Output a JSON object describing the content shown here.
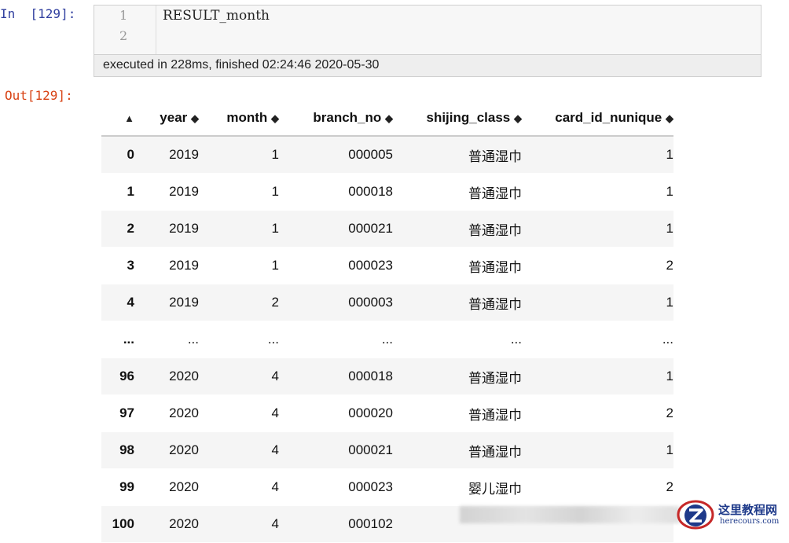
{
  "input_cell": {
    "prompt": "In  [129]:",
    "line_numbers": [
      "1",
      "2"
    ],
    "code": "RESULT_month",
    "exec_info": "executed in 228ms, finished 02:24:46 2020-05-30"
  },
  "output_cell": {
    "prompt": "Out[129]:",
    "sort_icon": "sort-arrows-icon",
    "columns": [
      "year",
      "month",
      "branch_no",
      "shijing_class",
      "card_id_nunique"
    ],
    "rows": [
      {
        "index": "0",
        "year": "2019",
        "month": "1",
        "branch_no": "000005",
        "shijing_class": "普通湿巾",
        "card_id_nunique": "1"
      },
      {
        "index": "1",
        "year": "2019",
        "month": "1",
        "branch_no": "000018",
        "shijing_class": "普通湿巾",
        "card_id_nunique": "1"
      },
      {
        "index": "2",
        "year": "2019",
        "month": "1",
        "branch_no": "000021",
        "shijing_class": "普通湿巾",
        "card_id_nunique": "1"
      },
      {
        "index": "3",
        "year": "2019",
        "month": "1",
        "branch_no": "000023",
        "shijing_class": "普通湿巾",
        "card_id_nunique": "2"
      },
      {
        "index": "4",
        "year": "2019",
        "month": "2",
        "branch_no": "000003",
        "shijing_class": "普通湿巾",
        "card_id_nunique": "1"
      },
      {
        "index": "...",
        "year": "...",
        "month": "...",
        "branch_no": "...",
        "shijing_class": "...",
        "card_id_nunique": "..."
      },
      {
        "index": "96",
        "year": "2020",
        "month": "4",
        "branch_no": "000018",
        "shijing_class": "普通湿巾",
        "card_id_nunique": "1"
      },
      {
        "index": "97",
        "year": "2020",
        "month": "4",
        "branch_no": "000020",
        "shijing_class": "普通湿巾",
        "card_id_nunique": "2"
      },
      {
        "index": "98",
        "year": "2020",
        "month": "4",
        "branch_no": "000021",
        "shijing_class": "普通湿巾",
        "card_id_nunique": "1"
      },
      {
        "index": "99",
        "year": "2020",
        "month": "4",
        "branch_no": "000023",
        "shijing_class": "婴儿湿巾",
        "card_id_nunique": "2"
      },
      {
        "index": "100",
        "year": "2020",
        "month": "4",
        "branch_no": "000102",
        "shijing_class": "",
        "card_id_nunique": ""
      }
    ]
  },
  "watermark": {
    "title": "这里教程网",
    "url": "herecours.com"
  },
  "colors": {
    "in_prompt": "#303f9f",
    "out_prompt": "#d84315",
    "cell_bg": "#f7f7f7",
    "stripe": "#f5f5f5",
    "watermark": "#1e3a8a"
  }
}
